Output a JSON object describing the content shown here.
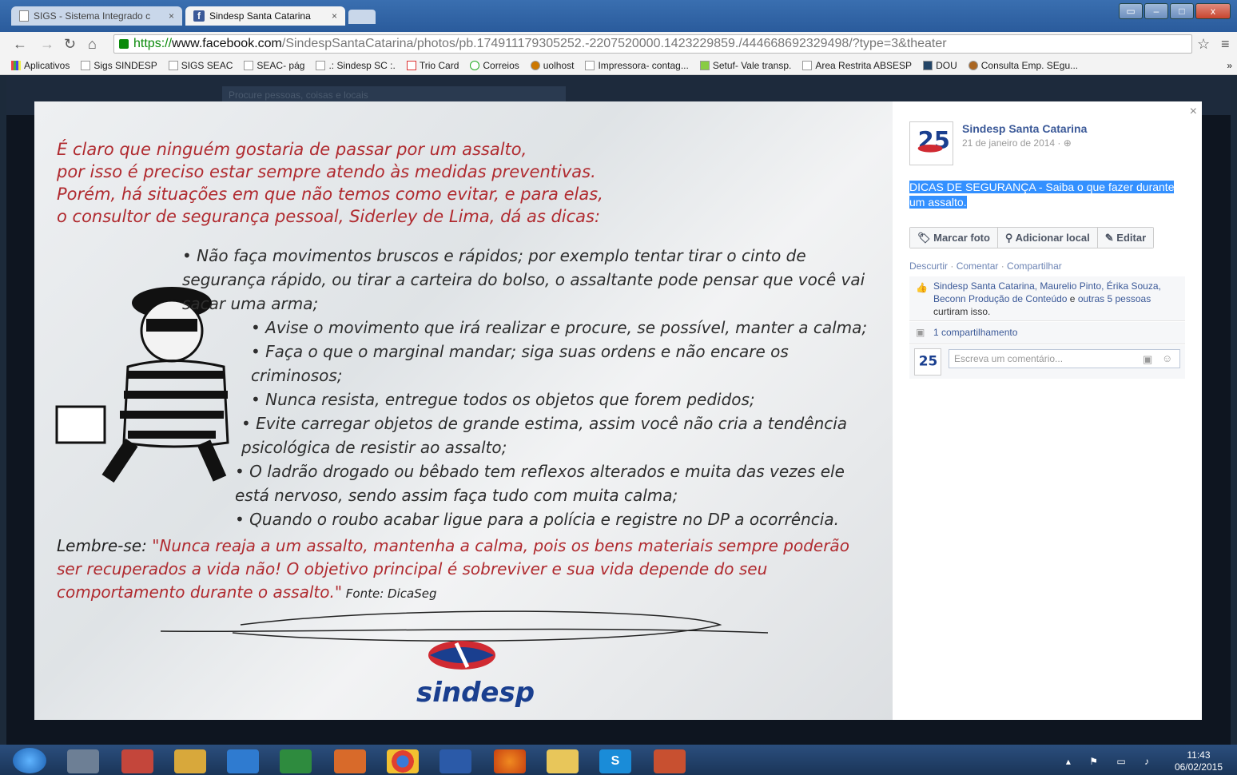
{
  "browser": {
    "tabs": [
      {
        "label": "SIGS - Sistema Integrado c",
        "close": "×"
      },
      {
        "label": "Sindesp Santa Catarina",
        "close": "×"
      }
    ],
    "window_buttons": [
      "▭",
      "–",
      "□",
      "x"
    ],
    "url": {
      "scheme": "https://",
      "domain": "www.facebook.com",
      "path": "/SindespSantaCatarina/photos/pb.174911179305252.-2207520000.1423229859./444668692329498/?type=3&theater"
    },
    "bookmarks": [
      "Aplicativos",
      "Sigs SINDESP",
      "SIGS SEAC",
      "SEAC- pág",
      ".: Sindesp SC :.",
      "Trio Card",
      "Correios",
      "uolhost",
      "Impressora- contag...",
      "Setuf- Vale transp.",
      "Area Restrita ABSESP",
      "DOU",
      "Consulta Emp. SEgu..."
    ],
    "overflow": "»"
  },
  "facebook": {
    "search_placeholder": "Procure pessoas, coisas e locais",
    "photo": {
      "intro": [
        "É claro que ninguém gostaria de passar por um assalto,",
        "por isso é preciso estar sempre atendo às medidas preventivas.",
        "Porém, há situações em que não temos como evitar, e para elas,",
        "o consultor de segurança pessoal, Siderley de Lima, dá as dicas:"
      ],
      "tips": [
        "• Não faça movimentos bruscos e rápidos; por exemplo tentar tirar o cinto de segurança rápido, ou tirar a carteira do bolso, o assaltante pode pensar que você vai sacar uma arma;",
        "• Avise o movimento que irá realizar e procure, se possível, manter a calma;",
        "• Faça o que o marginal mandar; siga suas ordens e não encare os criminosos;",
        "• Nunca resista, entregue todos os objetos que forem pedidos;",
        "• Evite carregar objetos de grande estima, assim você não cria a tendência psicológica de resistir ao assalto;",
        "• O ladrão drogado ou bêbado tem reflexos alterados e muita das vezes ele está nervoso, sendo assim faça tudo com muita calma;",
        "• Quando o roubo acabar ligue para a polícia e registre no DP a ocorrência."
      ],
      "reminder_label": "Lembre-se: ",
      "reminder_quote": "\"Nunca reaja a um assalto, mantenha a calma, pois os bens materiais sempre poderão ser recuperados a vida não! O objetivo principal é sobreviver e sua vida depende do seu comportamento durante o assalto.\"",
      "source": " Fonte: DicaSeg",
      "logo_text": "sindesp"
    },
    "sidebar": {
      "close": "×",
      "page_name": "Sindesp Santa Catarina",
      "date": "21 de janeiro de 2014 · ⊕",
      "caption": "DICAS DE SEGURANÇA - Saiba o que fazer durante um assalto.",
      "actions": [
        "Marcar foto",
        "Adicionar local",
        "Editar"
      ],
      "links": [
        "Descurtir",
        "Comentar",
        "Compartilhar"
      ],
      "likes_names": "Sindesp Santa Catarina, Maurelio Pinto, Érika Souza, Beconn Produção de Conteúdo",
      "likes_and": " e ",
      "likes_others": "outras 5 pessoas",
      "likes_suffix": " curtiram isso.",
      "shares": "1 compartilhamento",
      "comment_placeholder": "Escreva um comentário..."
    }
  },
  "taskbar": {
    "clock_time": "11:43",
    "clock_date": "06/02/2015"
  },
  "colors": {
    "accent_red": "#b02a2f",
    "fb_blue": "#3b5998",
    "selection": "#3390ff"
  }
}
